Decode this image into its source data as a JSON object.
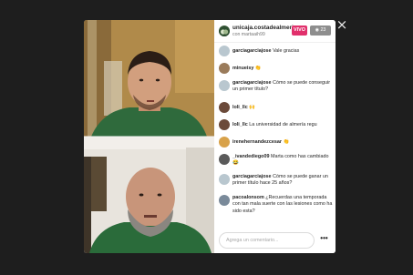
{
  "close_label": "×",
  "host": {
    "username": "unicaja.costadealmeria",
    "subtitle": "con martaaih99",
    "live_label": "VIVO",
    "viewer_count": "23",
    "viewer_icon": "eye-icon"
  },
  "comments": [
    {
      "user": "garciagarciajose",
      "text": "Vale gracias",
      "avatar_color": "#b9c7cf"
    },
    {
      "user": "minueisy",
      "text": "👏",
      "avatar_color": "#9a7b5b"
    },
    {
      "user": "garciagarciajose",
      "text": "Cómo se puede conseguir un primer título?",
      "avatar_color": "#b9c7cf"
    },
    {
      "user": "loli_llc",
      "text": "🙌",
      "avatar_color": "#6b4a3a"
    },
    {
      "user": "loli_llc",
      "text": "La universidad de almería regu",
      "avatar_color": "#6b4a3a"
    },
    {
      "user": "irenehernandezcesar",
      "text": "👏",
      "avatar_color": "#d8a24a"
    },
    {
      "user": "_ivandediego09",
      "text": "Marta como has cambiado 😂",
      "avatar_color": "#5a5a5a"
    },
    {
      "user": "garciagarciajose",
      "text": "Cómo se puede ganar un primer título hace 25 años?",
      "avatar_color": "#b9c7cf"
    },
    {
      "user": "pacoalonsom",
      "text": "¿Recuerdas una temporada con tan mala suerte con las lesiones como ha sido esta?",
      "avatar_color": "#7a8a9a"
    }
  ],
  "composer": {
    "placeholder": "Agrega un comentario...",
    "more_label": "•••"
  }
}
